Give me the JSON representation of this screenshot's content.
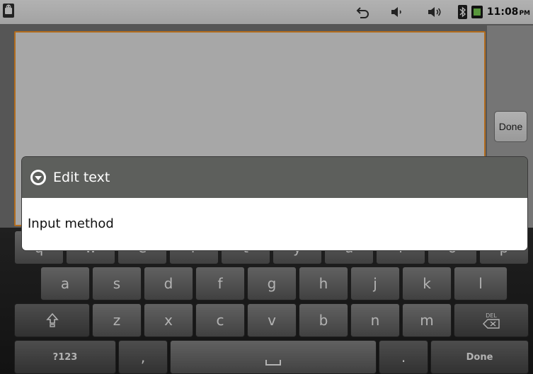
{
  "status_bar": {
    "time": "11:08",
    "ampm": "PM",
    "icons": [
      "android-notification-icon",
      "back-arrow-icon",
      "volume-icon",
      "speaker-icon",
      "bluetooth-icon",
      "battery-icon"
    ]
  },
  "extract_view": {
    "text": "",
    "done_label": "Done"
  },
  "dialog": {
    "title": "Edit text",
    "items": [
      {
        "label": "Input method"
      }
    ]
  },
  "keyboard": {
    "row1": [
      "q",
      "w",
      "e",
      "r",
      "t",
      "y",
      "u",
      "i",
      "o",
      "p"
    ],
    "row2": [
      "a",
      "s",
      "d",
      "f",
      "g",
      "h",
      "j",
      "k",
      "l"
    ],
    "row3": [
      "z",
      "x",
      "c",
      "v",
      "b",
      "n",
      "m"
    ],
    "del_label": "DEL",
    "symbols_label": "?123",
    "comma_label": ",",
    "period_label": ".",
    "done_label": "Done"
  },
  "colors": {
    "focus_border": "#ff9b2a",
    "dialog_header": "#5d5f5c",
    "key": "#6e6e6e"
  }
}
